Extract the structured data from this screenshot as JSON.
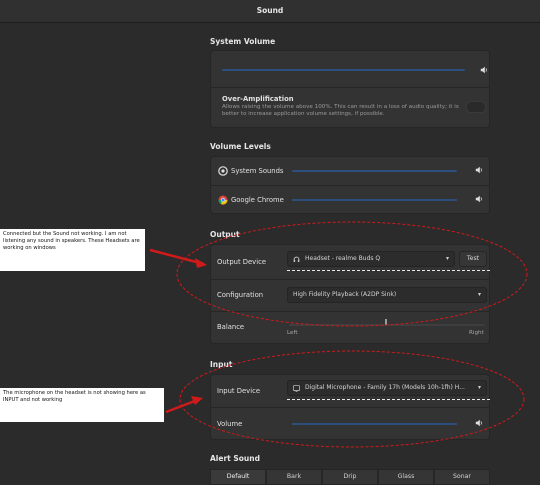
{
  "window": {
    "title": "Sound"
  },
  "system_volume": {
    "heading": "System Volume",
    "over_amp_title": "Over-Amplification",
    "over_amp_desc": "Allows raising the volume above 100%. This can result in a loss of audio quality; it is better to increase application volume settings, if possible."
  },
  "volume_levels": {
    "heading": "Volume Levels",
    "apps": [
      {
        "label": "System Sounds",
        "icon": "system-sounds-icon"
      },
      {
        "label": "Google Chrome",
        "icon": "chrome-icon"
      }
    ]
  },
  "output": {
    "heading": "Output",
    "device_label": "Output Device",
    "device_value": "Headset - realme Buds Q",
    "test_label": "Test",
    "config_label": "Configuration",
    "config_value": "High Fidelity Playback (A2DP Sink)",
    "balance_label": "Balance",
    "balance_left": "Left",
    "balance_right": "Right"
  },
  "input": {
    "heading": "Input",
    "device_label": "Input Device",
    "device_value": "Digital Microphone - Family 17h (Models 10h-1fh) H...",
    "volume_label": "Volume"
  },
  "alert_sound": {
    "heading": "Alert Sound",
    "options": [
      "Default",
      "Bark",
      "Drip",
      "Glass",
      "Sonar"
    ],
    "selected": "Default"
  },
  "annotations": {
    "note1": "Connected but the Sound not working. I am not listening any sound in speakers. These Headsets are working on windows",
    "note2": "The microphone on the headset is not showing here as INPUT and not working"
  },
  "colors": {
    "annotation": "#d11a1a",
    "slider_track": "#2d4f7d",
    "background": "#2b2b2b"
  }
}
